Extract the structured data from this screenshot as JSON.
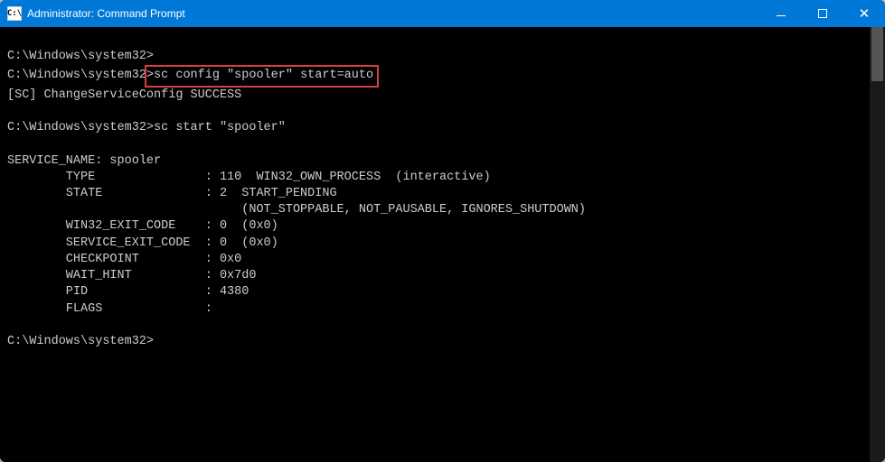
{
  "titlebar": {
    "icon_text": "C:\\",
    "title": "Administrator: Command Prompt"
  },
  "term": {
    "prompt1_path": "C:\\Windows\\system32>",
    "prompt2_path": "C:\\Windows\\system32",
    "cmd_config": "sc config \"spooler\" start=auto",
    "prompt2_gt": ">",
    "sc_response": "[SC] ChangeServiceConfig SUCCESS",
    "prompt3_path": "C:\\Windows\\system32>",
    "cmd_start": "sc start \"spooler\"",
    "svc_name": "SERVICE_NAME: spooler",
    "row_type": "        TYPE               : 110  WIN32_OWN_PROCESS  (interactive)",
    "row_state": "        STATE              : 2  START_PENDING",
    "row_state2": "                                (NOT_STOPPABLE, NOT_PAUSABLE, IGNORES_SHUTDOWN)",
    "row_w32exit": "        WIN32_EXIT_CODE    : 0  (0x0)",
    "row_svcexit": "        SERVICE_EXIT_CODE  : 0  (0x0)",
    "row_chk": "        CHECKPOINT         : 0x0",
    "row_wait": "        WAIT_HINT          : 0x7d0",
    "row_pid": "        PID                : 4380",
    "row_flags": "        FLAGS              :",
    "prompt4_path": "C:\\Windows\\system32>"
  }
}
